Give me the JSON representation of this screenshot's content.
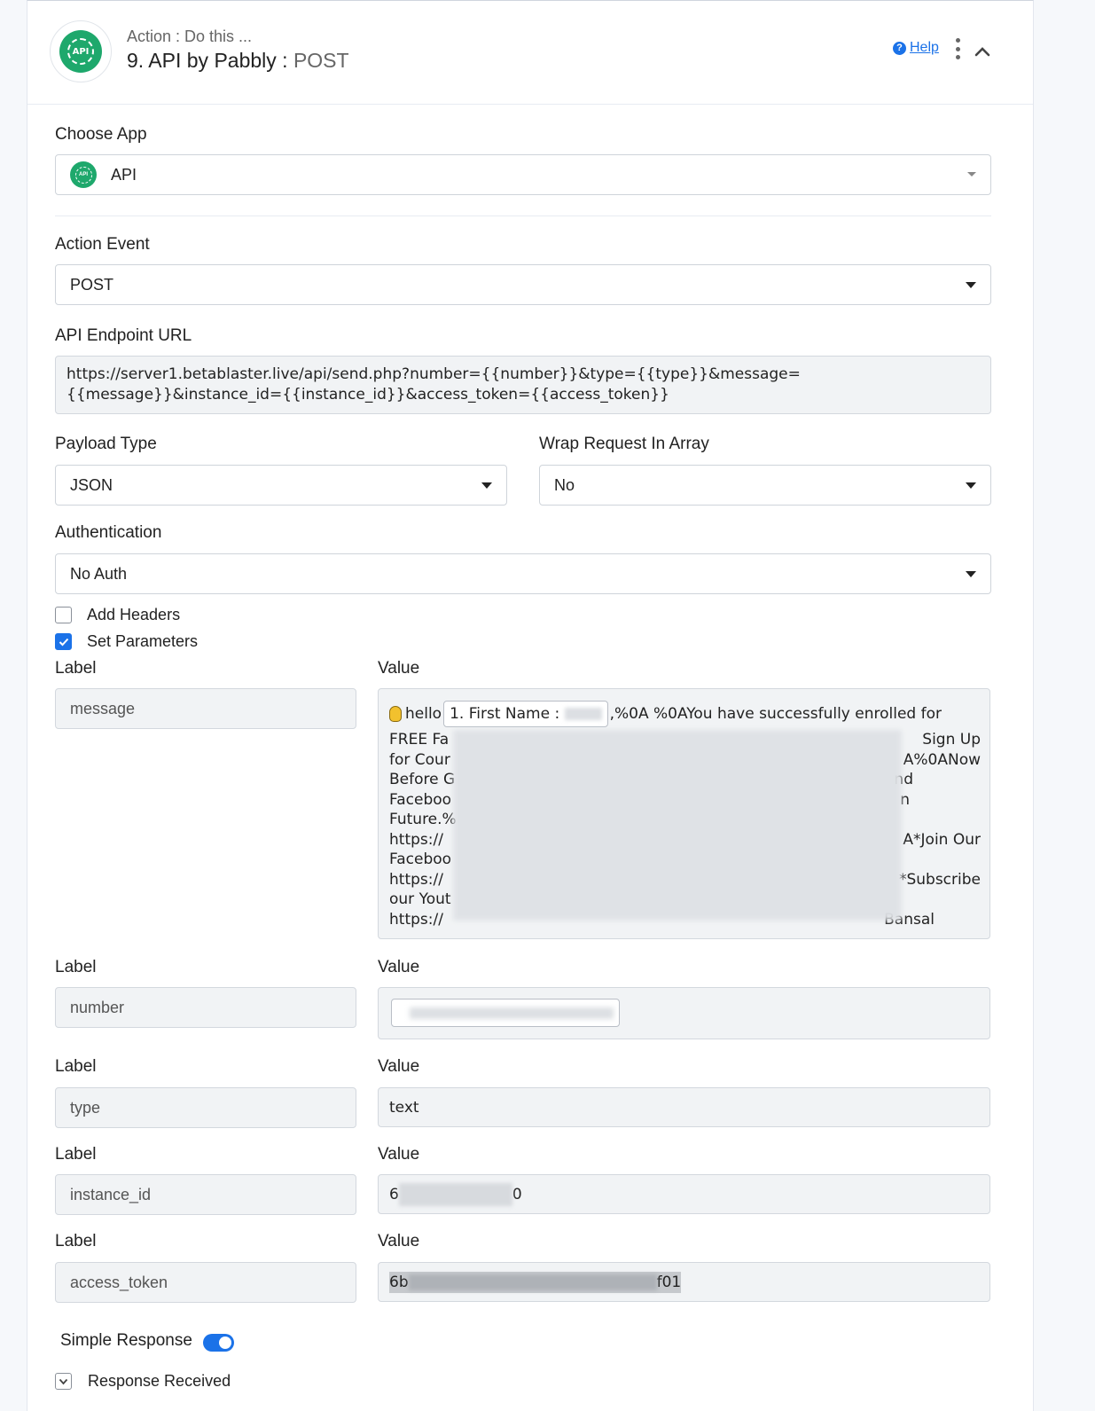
{
  "header": {
    "subtitle": "Action : Do this ...",
    "title": "9. API by Pabbly :",
    "event": "POST",
    "help_label": "Help",
    "logo_text": "API"
  },
  "choose_app": {
    "label": "Choose App",
    "value": "API",
    "logo_text": "API"
  },
  "action_event": {
    "label": "Action Event",
    "value": "POST"
  },
  "endpoint": {
    "label": "API Endpoint URL",
    "line1": "https://server1.betablaster.live/api/send.php?number={{number}}&type={{type}}&message=",
    "line2": "{{message}}&instance_id={{instance_id}}&access_token={{access_token}}"
  },
  "payload_type": {
    "label": "Payload Type",
    "value": "JSON"
  },
  "wrap_request": {
    "label": "Wrap Request In Array",
    "value": "No"
  },
  "authentication": {
    "label": "Authentication",
    "value": "No Auth"
  },
  "add_headers": {
    "label": "Add Headers",
    "checked": false
  },
  "set_parameters": {
    "label": "Set Parameters",
    "checked": true
  },
  "parameters": {
    "label_header": "Label",
    "value_header": "Value",
    "rows": [
      {
        "label": "message",
        "value_prefix": "hello",
        "chip": "1. First Name : ",
        "value_first_rest": ",%0A %0AYou have successfully enrolled for",
        "value_lines": [
          "FREE Fa",
          "for Cour",
          "Before G",
          "Faceboo",
          "Future.%",
          "https://",
          "Faceboo",
          "https://",
          "our Yout",
          "https://"
        ],
        "value_right": [
          "Sign Up",
          "A%0ANow",
          "nd",
          "n",
          "",
          "A*Join Our",
          "",
          "*Subscribe",
          "",
          "Bansal"
        ]
      },
      {
        "label": "number",
        "value": ""
      },
      {
        "label": "type",
        "value": "text"
      },
      {
        "label": "instance_id",
        "value_start": "6",
        "value_end": "0"
      },
      {
        "label": "access_token",
        "value_start": "6b",
        "value_end": "f01"
      }
    ]
  },
  "simple_response": {
    "label": "Simple Response",
    "enabled": true
  },
  "response_received": {
    "label": "Response Received"
  },
  "colors": {
    "accent": "#1b72e8",
    "brand_green": "#1ea86c"
  }
}
